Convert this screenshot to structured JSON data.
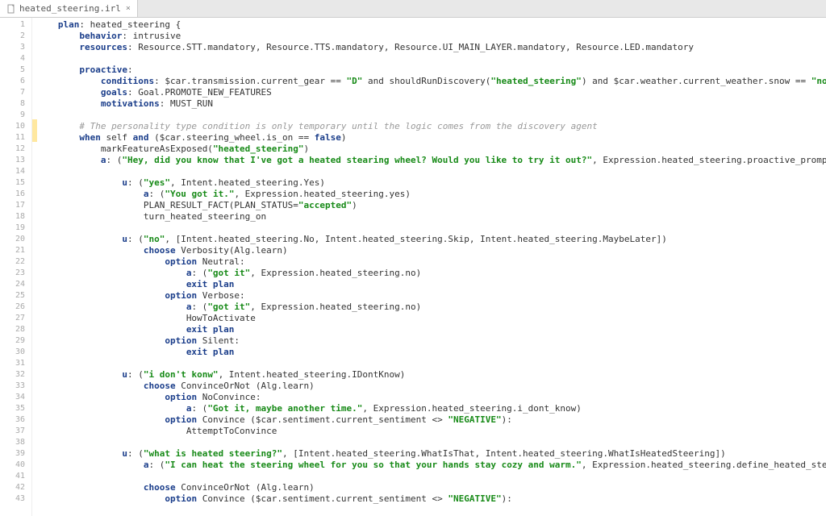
{
  "tab": {
    "filename": "heated_steering.irl",
    "close": "×"
  },
  "gutter": {
    "start": 1,
    "end": 43
  },
  "highlight_lines": [
    10,
    11
  ],
  "code": {
    "l1": {
      "kw": "plan",
      "rest": ": heated_steering {"
    },
    "l2": {
      "kw": "behavior",
      "rest": ": intrusive"
    },
    "l3": {
      "kw": "resources",
      "rest": ": Resource.STT.mandatory, Resource.TTS.mandatory, Resource.UI_MAIN_LAYER.mandatory, Resource.LED.mandatory"
    },
    "l5": {
      "kw": "proactive",
      "rest": ":"
    },
    "l6": {
      "kw": "conditions",
      "p1": ": $car.transmission.current_gear == ",
      "s1": "\"D\"",
      "p2": " and shouldRunDiscovery(",
      "s2": "\"heated_steering\"",
      "p3": ") and $car.weather.current_weather.snow == ",
      "s3": "\"none\""
    },
    "l7": {
      "kw": "goals",
      "rest": ": Goal.PROMOTE_NEW_FEATURES"
    },
    "l8": {
      "kw": "motivations",
      "rest": ": MUST_RUN"
    },
    "l10": {
      "cmt": "# The personality type condition is only temporary until the logic comes from the discovery agent"
    },
    "l11": {
      "kw": "when",
      "p1": " self ",
      "kw2": "and",
      "p2": " ($car.steering_wheel.is_on == ",
      "kw3": "false",
      "p3": ")"
    },
    "l12": {
      "p1": "markFeatureAsExposed(",
      "s1": "\"heated_steering\"",
      "p2": ")"
    },
    "l13": {
      "kw": "a",
      "p1": ": (",
      "s1": "\"Hey, did you know that I've got a heated stearing wheel? Would you like to try it out?\"",
      "p2": ", Expression.heated_steering.proactive_prompt)"
    },
    "l15": {
      "kw": "u",
      "p1": ": (",
      "s1": "\"yes\"",
      "p2": ", Intent.heated_steering.Yes)"
    },
    "l16": {
      "kw": "a",
      "p1": ": (",
      "s1": "\"You got it.\"",
      "p2": ", Expression.heated_steering.yes)"
    },
    "l17": {
      "p1": "PLAN_RESULT_FACT(PLAN_STATUS=",
      "s1": "\"accepted\"",
      "p2": ")"
    },
    "l18": {
      "rest": "turn_heated_steering_on"
    },
    "l20": {
      "kw": "u",
      "p1": ": (",
      "s1": "\"no\"",
      "p2": ", [Intent.heated_steering.No, Intent.heated_steering.Skip, Intent.heated_steering.MaybeLater])"
    },
    "l21": {
      "kw": "choose",
      "rest": " Verbosity(Alg.learn)"
    },
    "l22": {
      "kw": "option",
      "rest": " Neutral:"
    },
    "l23": {
      "kw": "a",
      "p1": ": (",
      "s1": "\"got it\"",
      "p2": ", Expression.heated_steering.no)"
    },
    "l24": {
      "kw": "exit plan"
    },
    "l25": {
      "kw": "option",
      "rest": " Verbose:"
    },
    "l26": {
      "kw": "a",
      "p1": ": (",
      "s1": "\"got it\"",
      "p2": ", Expression.heated_steering.no)"
    },
    "l27": {
      "rest": "HowToActivate"
    },
    "l28": {
      "kw": "exit plan"
    },
    "l29": {
      "kw": "option",
      "rest": " Silent:"
    },
    "l30": {
      "kw": "exit plan"
    },
    "l32": {
      "kw": "u",
      "p1": ": (",
      "s1": "\"i don't konw\"",
      "p2": ", Intent.heated_steering.IDontKnow)"
    },
    "l33": {
      "kw": "choose",
      "rest": " ConvinceOrNot (Alg.learn)"
    },
    "l34": {
      "kw": "option",
      "rest": " NoConvince:"
    },
    "l35": {
      "kw": "a",
      "p1": ": (",
      "s1": "\"Got it, maybe another time.\"",
      "p2": ", Expression.heated_steering.i_dont_know)"
    },
    "l36": {
      "kw": "option",
      "p1": " Convince ($car.sentiment.current_sentiment <> ",
      "s1": "\"NEGATIVE\"",
      "p2": "):"
    },
    "l37": {
      "rest": "AttemptToConvince"
    },
    "l39": {
      "kw": "u",
      "p1": ": (",
      "s1": "\"what is heated steering?\"",
      "p2": ", [Intent.heated_steering.WhatIsThat, Intent.heated_steering.WhatIsHeatedSteering])"
    },
    "l40": {
      "kw": "a",
      "p1": ": (",
      "s1": "\"I can heat the steering wheel for you so that your hands stay cozy and warm.\"",
      "p2": ", Expression.heated_steering.define_heated_steering)"
    },
    "l42": {
      "kw": "choose",
      "rest": " ConvinceOrNot (Alg.learn)"
    },
    "l43": {
      "kw": "option",
      "p1": " Convince ($car.sentiment.current_sentiment <> ",
      "s1": "\"NEGATIVE\"",
      "p2": "):"
    }
  },
  "indent": {
    "l1": 3,
    "l2": 7,
    "l3": 7,
    "l5": 7,
    "l6": 11,
    "l7": 11,
    "l8": 11,
    "l10": 7,
    "l11": 7,
    "l12": 11,
    "l13": 11,
    "l15": 15,
    "l16": 19,
    "l17": 19,
    "l18": 19,
    "l20": 15,
    "l21": 19,
    "l22": 23,
    "l23": 27,
    "l24": 27,
    "l25": 23,
    "l26": 27,
    "l27": 27,
    "l28": 27,
    "l29": 23,
    "l30": 27,
    "l32": 15,
    "l33": 19,
    "l34": 23,
    "l35": 27,
    "l36": 23,
    "l37": 27,
    "l39": 15,
    "l40": 19,
    "l42": 19,
    "l43": 23
  }
}
